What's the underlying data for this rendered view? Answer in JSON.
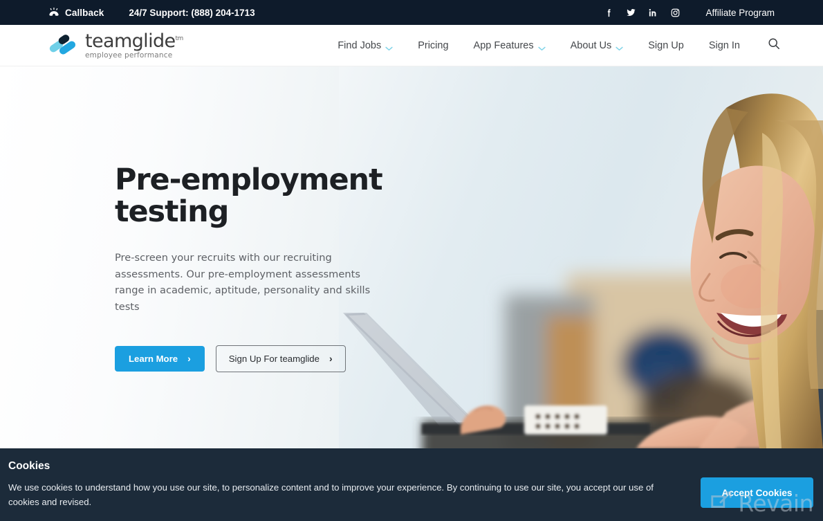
{
  "topbar": {
    "callback_label": "Callback",
    "callback_icon": "ringing-phone-icon",
    "support_label": "24/7 Support:",
    "support_phone": "(888) 204-1713",
    "social": [
      {
        "name": "facebook-icon",
        "label": "f"
      },
      {
        "name": "twitter-icon",
        "label": "t"
      },
      {
        "name": "linkedin-icon",
        "label": "in"
      },
      {
        "name": "instagram-icon",
        "label": "ig"
      }
    ],
    "affiliate_label": "Affiliate Program",
    "background": "#0e1b2b"
  },
  "header": {
    "logo": {
      "word": "teamglide",
      "tm": "tm",
      "tagline": "employee performance",
      "mark_icon": "teamglide-capsules-logo",
      "colors": {
        "dark": "#0d2436",
        "mid": "#2eaae1",
        "light": "#7fd3e8"
      }
    },
    "nav": [
      {
        "label": "Find Jobs",
        "has_dropdown": true
      },
      {
        "label": "Pricing",
        "has_dropdown": false
      },
      {
        "label": "App Features",
        "has_dropdown": true
      },
      {
        "label": "About Us",
        "has_dropdown": true
      },
      {
        "label": "Sign Up",
        "has_dropdown": false
      },
      {
        "label": "Sign In",
        "has_dropdown": false
      }
    ],
    "search_icon": "search-icon"
  },
  "hero": {
    "title_line1": "Pre-employment",
    "title_line2": "testing",
    "subtitle": "Pre-screen your recruits with our recruiting assessments. Our pre-employment assessments range in academic, aptitude, personality and skills tests",
    "primary_button": "Learn More",
    "secondary_button": "Sign Up For teamglide",
    "arrow_glyph": "›",
    "accent_color": "#1b9fe0"
  },
  "cookie": {
    "title": "Cookies",
    "text": "We use cookies to understand how you use our site, to personalize content and to improve your experience. By continuing to use our site, you accept our use of cookies and revised.",
    "accept_label": "Accept Cookies",
    "background": "#1c2b3a"
  },
  "watermark": {
    "text": "Revain",
    "icon": "revain-logo-icon"
  }
}
